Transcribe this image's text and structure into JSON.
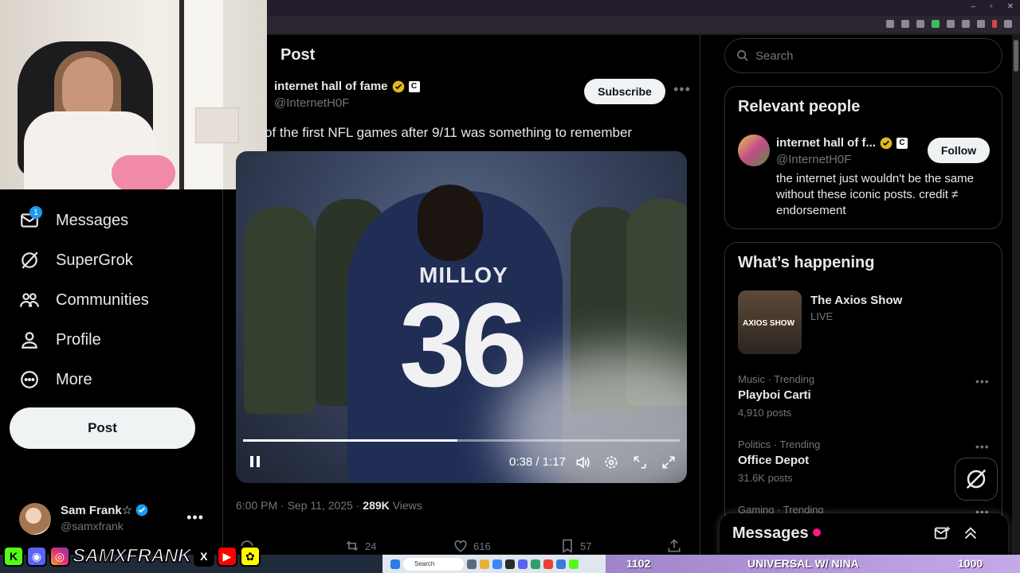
{
  "browser": {
    "window_controls": [
      "–",
      "▫",
      "✕"
    ]
  },
  "nav": {
    "items": [
      {
        "label": "Messages",
        "badge": "1",
        "icon": "mail-icon"
      },
      {
        "label": "SuperGrok",
        "icon": "grok-icon"
      },
      {
        "label": "Communities",
        "icon": "communities-icon"
      },
      {
        "label": "Profile",
        "icon": "profile-icon"
      },
      {
        "label": "More",
        "icon": "more-circle-icon"
      }
    ],
    "post_button": "Post"
  },
  "account": {
    "name": "Sam Frank☆",
    "handle": "@samxfrank",
    "more": "•••"
  },
  "post": {
    "header": "Post",
    "author_name": "internet hall of fame",
    "author_badge": "C",
    "author_handle": "@InternetH0F",
    "subscribe_label": "Subscribe",
    "more": "•••",
    "text": "of the first NFL games after 9/11 was something to remember",
    "meta_time": "6:00 PM · Sep 11, 2025 · ",
    "meta_views_count": "289K",
    "meta_views_label": " Views"
  },
  "video": {
    "jersey_name": "MILLOY",
    "jersey_number": "36",
    "time": "0:38 / 1:17",
    "progress": 0.49
  },
  "actions": {
    "reposts": "24",
    "likes": "616",
    "bookmarks": "57"
  },
  "right": {
    "search_placeholder": "Search",
    "relevant_title": "Relevant people",
    "rp_name": "internet hall of f...",
    "rp_badge": "C",
    "rp_handle": "@InternetH0F",
    "follow_label": "Follow",
    "rp_bio": "the internet just wouldn't be the same without these iconic posts. credit ≠ endorsement",
    "happening_title": "What’s happening",
    "show_name": "The Axios Show",
    "show_status": "LIVE",
    "show_thumb_text": "AXIOS SHOW",
    "trends": [
      {
        "category": "Music · Trending",
        "name": "Playboi Carti",
        "count": "4,910 posts"
      },
      {
        "category": "Politics · Trending",
        "name": "Office Depot",
        "count": "31.6K posts"
      },
      {
        "category": "Gaming · Trending",
        "name": "",
        "count": ""
      }
    ],
    "trend_more": "•••"
  },
  "messages_drawer": {
    "title": "Messages"
  },
  "overlay": {
    "social_handle": "SAMXFRANK",
    "taskbar_search": "Search",
    "left_count": "1102",
    "center_text": "UNIVERSAL W/ NINA",
    "right_count": "1000"
  },
  "colors": {
    "accent": "#1d9bf0",
    "gold_check": "#e2b719",
    "pink_dot": "#f91880",
    "stream_purple": "#b597dc"
  }
}
